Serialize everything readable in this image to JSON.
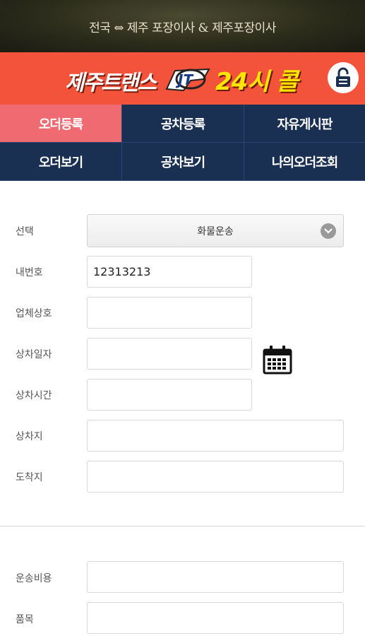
{
  "banner": {
    "text": "전국 ⇔ 제주 포장이사 & 제주포장이사"
  },
  "brand": {
    "name": "제주트랜스",
    "logo_text": "JT",
    "call_text": "24시 콜",
    "accent": "#f3533a",
    "call_color": "#ffe400",
    "lock_icon": "lock-icon"
  },
  "nav": {
    "items": [
      {
        "label": "오더등록",
        "active": true
      },
      {
        "label": "공차등록",
        "active": false
      },
      {
        "label": "자유게시판",
        "active": false
      },
      {
        "label": "오더보기",
        "active": false
      },
      {
        "label": "공차보기",
        "active": false
      },
      {
        "label": "나의오더조회",
        "active": false
      }
    ],
    "colors": {
      "default": "#1a3052",
      "active": "#f06a72"
    }
  },
  "form": {
    "select": {
      "label": "선택",
      "value": "화물운송",
      "icon": "chevron-down-icon"
    },
    "phone": {
      "label": "내번호",
      "value": "12313213"
    },
    "company": {
      "label": "업체상호",
      "value": ""
    },
    "load_date": {
      "label": "상차일자",
      "value": "",
      "icon": "calendar-icon"
    },
    "load_time": {
      "label": "상차시간",
      "value": ""
    },
    "origin": {
      "label": "상차지",
      "value": ""
    },
    "destination": {
      "label": "도착지",
      "value": ""
    },
    "fee": {
      "label": "운송비용",
      "value": ""
    },
    "item": {
      "label": "품목",
      "value": ""
    }
  }
}
